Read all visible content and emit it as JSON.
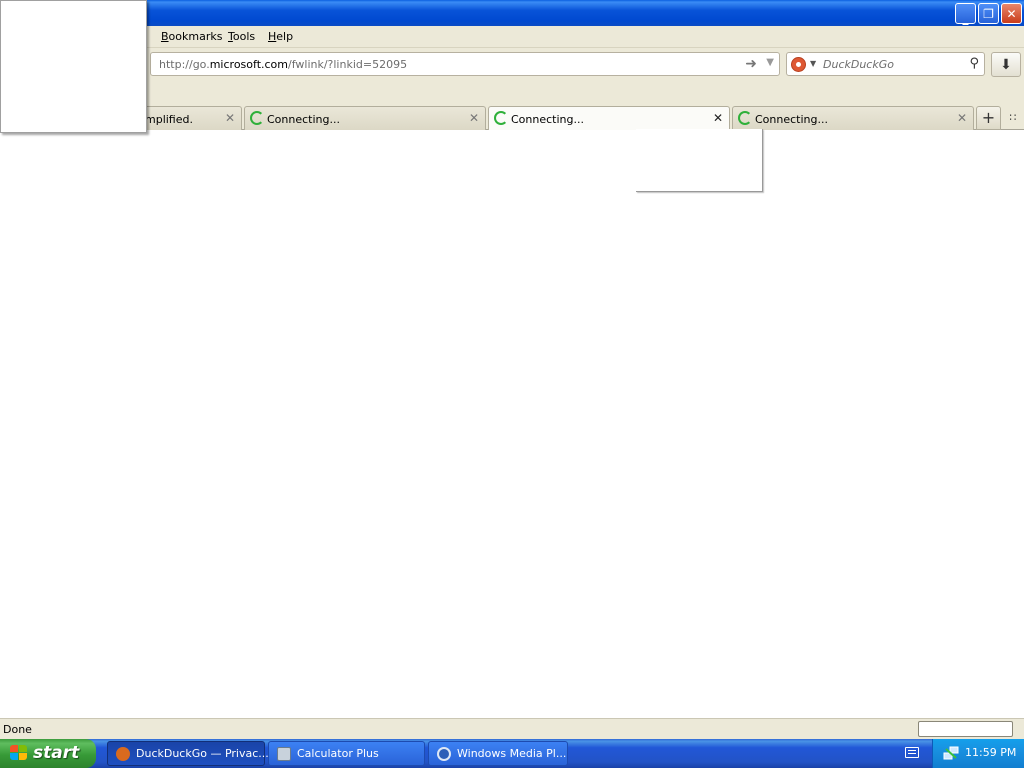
{
  "menubar": {
    "items": [
      {
        "label": "Bookmarks",
        "accel": "B"
      },
      {
        "label": "Tools",
        "accel": "T"
      },
      {
        "label": "Help",
        "accel": "H"
      }
    ]
  },
  "navbar": {
    "url_prefix": "http://go.",
    "url_host": "microsoft.com",
    "url_suffix": "/fwlink/?linkid=52095",
    "search_placeholder": "DuckDuckGo"
  },
  "tabs": [
    {
      "label": "mplified.",
      "selected": false
    },
    {
      "label": "Connecting...",
      "selected": false
    },
    {
      "label": "Connecting...",
      "selected": true
    },
    {
      "label": "Connecting...",
      "selected": false
    }
  ],
  "status": {
    "text": "Done"
  },
  "taskbar": {
    "start_label": "start",
    "buttons": [
      {
        "label": "DuckDuckGo — Privac...",
        "active": true
      },
      {
        "label": "Calculator Plus",
        "active": false
      },
      {
        "label": "Windows Media Pl...",
        "active": false
      }
    ],
    "clock": "11:59 PM"
  },
  "colors": {
    "titlebar_blue": "#0853d8",
    "taskbar_blue": "#2353c6",
    "start_green": "#379a37",
    "spinner_green": "#2fb03a",
    "chrome_beige": "#ece9d8"
  }
}
